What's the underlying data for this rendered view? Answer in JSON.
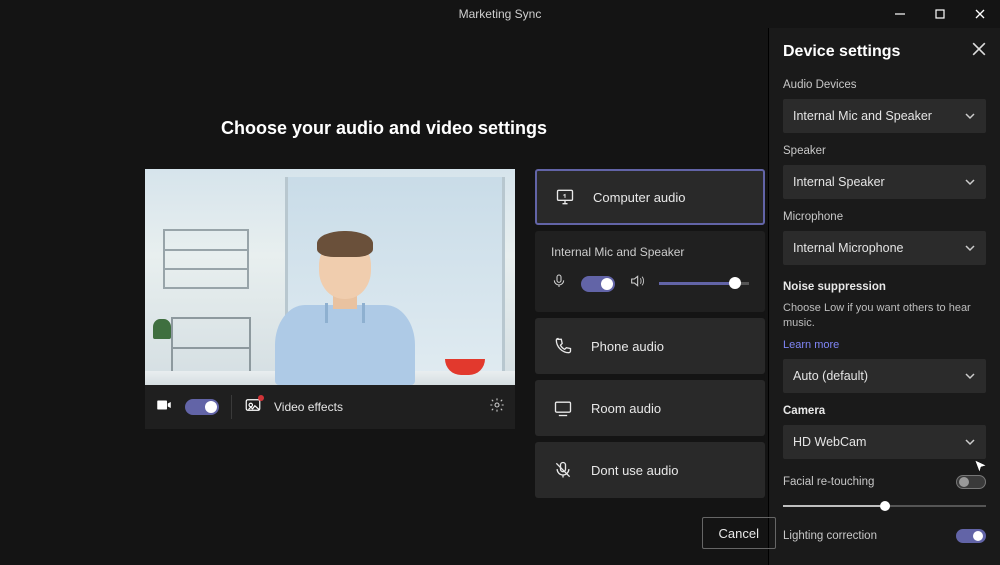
{
  "window": {
    "title": "Marketing Sync"
  },
  "main": {
    "heading": "Choose your audio and video settings",
    "controlbar": {
      "video_effects": "Video effects"
    },
    "options": {
      "computer_audio": "Computer audio",
      "sub_heading": "Internal Mic and Speaker",
      "phone_audio": "Phone audio",
      "room_audio": "Room audio",
      "dont_use_audio": "Dont use audio"
    },
    "footer": {
      "cancel": "Cancel"
    }
  },
  "panel": {
    "title": "Device settings",
    "audio_devices": {
      "label": "Audio Devices",
      "value": "Internal Mic and Speaker"
    },
    "speaker": {
      "label": "Speaker",
      "value": "Internal Speaker"
    },
    "microphone": {
      "label": "Microphone",
      "value": "Internal Microphone"
    },
    "noise": {
      "title": "Noise suppression",
      "desc": "Choose Low if you want others to hear music.",
      "learn": "Learn more",
      "value": "Auto (default)"
    },
    "camera": {
      "label": "Camera",
      "value": "HD WebCam"
    },
    "facial": "Facial re-touching",
    "lighting": "Lighting correction"
  }
}
